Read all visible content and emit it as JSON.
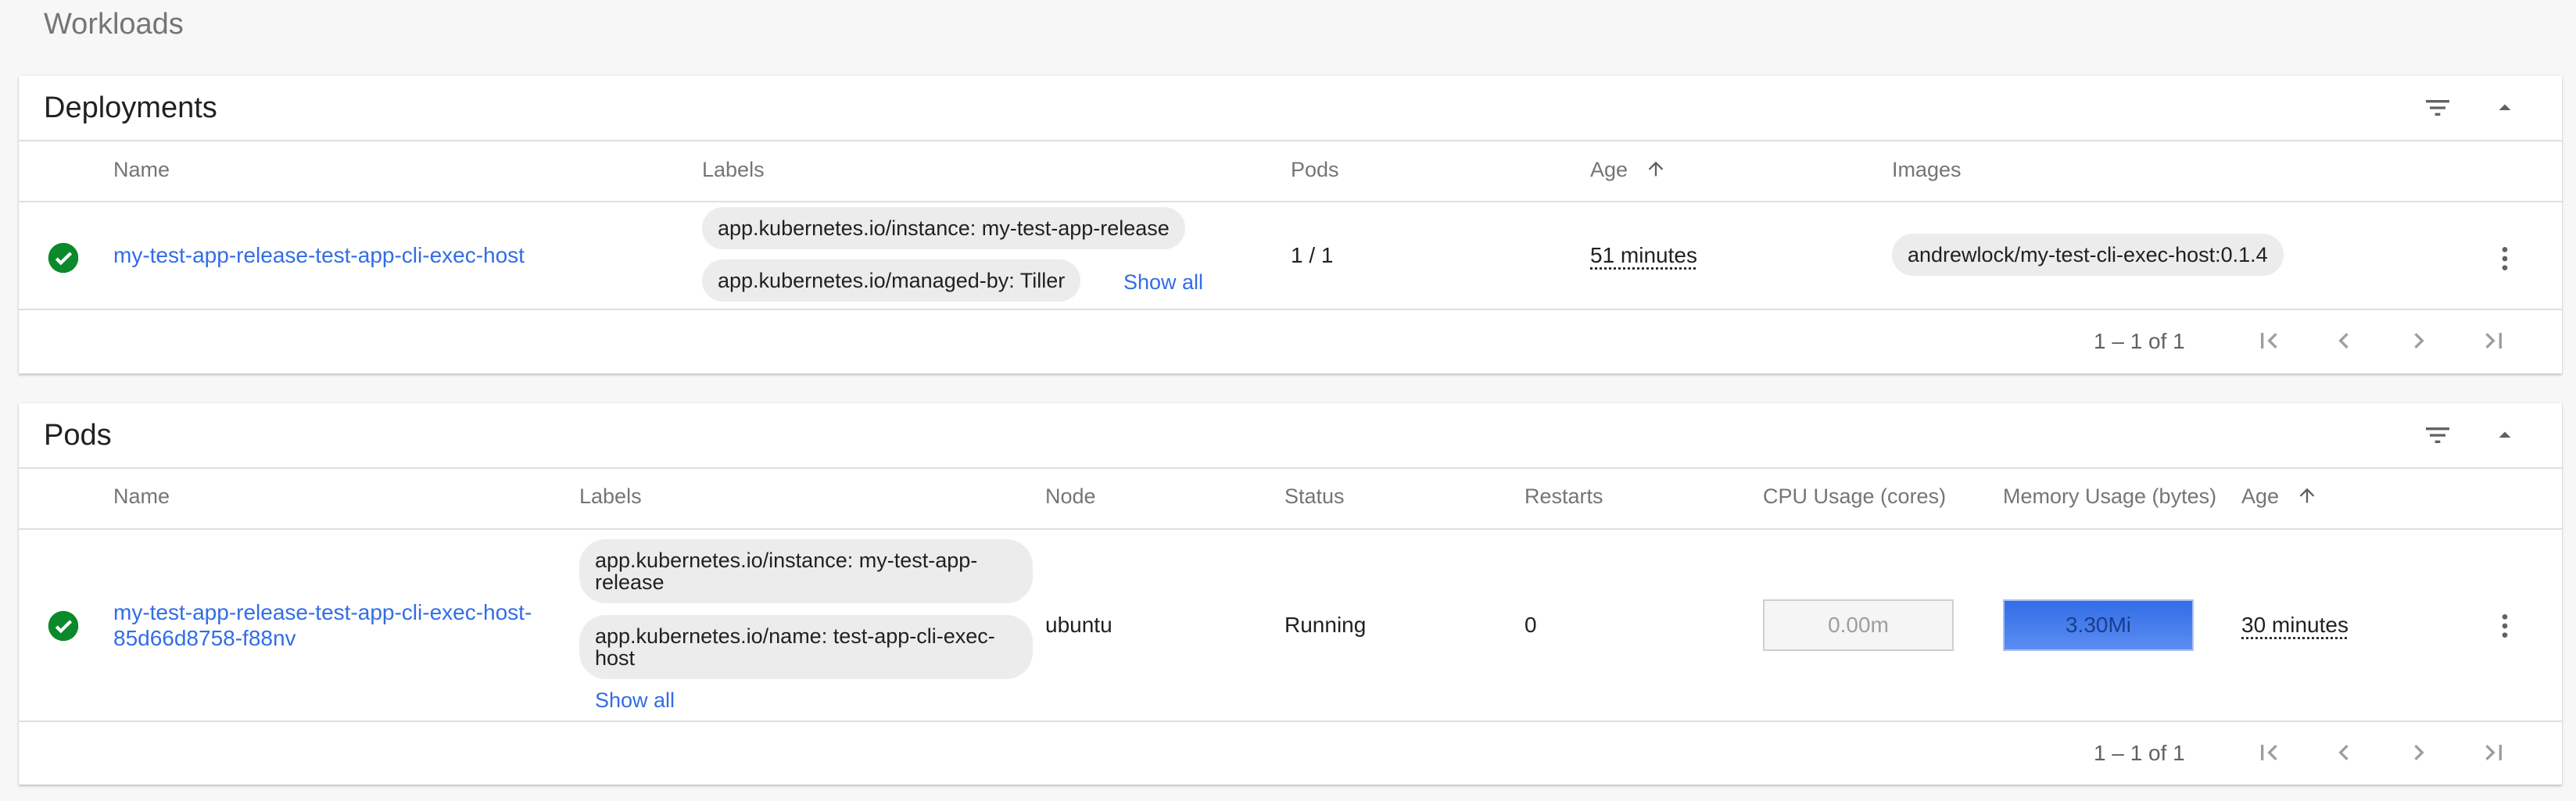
{
  "page": {
    "title": "Workloads"
  },
  "deployments": {
    "title": "Deployments",
    "columns": {
      "name": "Name",
      "labels": "Labels",
      "pods": "Pods",
      "age": "Age",
      "images": "Images"
    },
    "row": {
      "name": "my-test-app-release-test-app-cli-exec-host",
      "labels": [
        "app.kubernetes.io/instance: my-test-app-release",
        "app.kubernetes.io/managed-by: Tiller"
      ],
      "show_all": "Show all",
      "pods": "1 / 1",
      "age": "51 minutes",
      "image": "andrewlock/my-test-cli-exec-host:0.1.4"
    },
    "pagination": "1 – 1 of 1"
  },
  "pods": {
    "title": "Pods",
    "columns": {
      "name": "Name",
      "labels": "Labels",
      "node": "Node",
      "status": "Status",
      "restarts": "Restarts",
      "cpu": "CPU Usage (cores)",
      "memory": "Memory Usage (bytes)",
      "age": "Age"
    },
    "row": {
      "name": "my-test-app-release-test-app-cli-exec-host-85d66d8758-f88nv",
      "labels": [
        "app.kubernetes.io/instance: my-test-app-release",
        "app.kubernetes.io/name: test-app-cli-exec-host"
      ],
      "show_all": "Show all",
      "node": "ubuntu",
      "status": "Running",
      "restarts": "0",
      "cpu": "0.00m",
      "memory": "3.30Mi",
      "age": "30 minutes"
    },
    "pagination": "1 – 1 of 1"
  },
  "colors": {
    "accent": "#326de6",
    "success": "#0a8a2a",
    "muted": "#757575"
  },
  "icons": [
    "filter-icon",
    "collapse-icon",
    "check-circle-icon",
    "more-vert-icon",
    "first-page-icon",
    "prev-page-icon",
    "next-page-icon",
    "last-page-icon",
    "sort-arrow-up-icon"
  ]
}
